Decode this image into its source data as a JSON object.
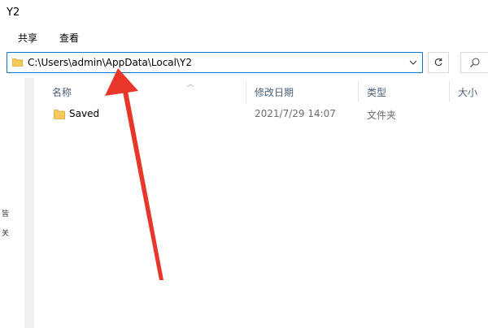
{
  "window": {
    "title": "Y2"
  },
  "ribbon": {
    "tabs": [
      "共享",
      "查看"
    ]
  },
  "address_bar": {
    "path": "C:\\Users\\admin\\AppData\\Local\\Y2"
  },
  "columns": {
    "name": "名称",
    "date_modified": "修改日期",
    "type": "类型",
    "size": "大小"
  },
  "files": [
    {
      "name": "Saved",
      "date_modified": "2021/7/29 14:07",
      "type": "文件夹",
      "icon": "folder-icon"
    }
  ],
  "left_pane": {
    "labels": [
      "皆",
      "关"
    ]
  },
  "colors": {
    "accent": "#0078d7",
    "folder": "#f6c95b",
    "arrow": "#e8362a"
  }
}
